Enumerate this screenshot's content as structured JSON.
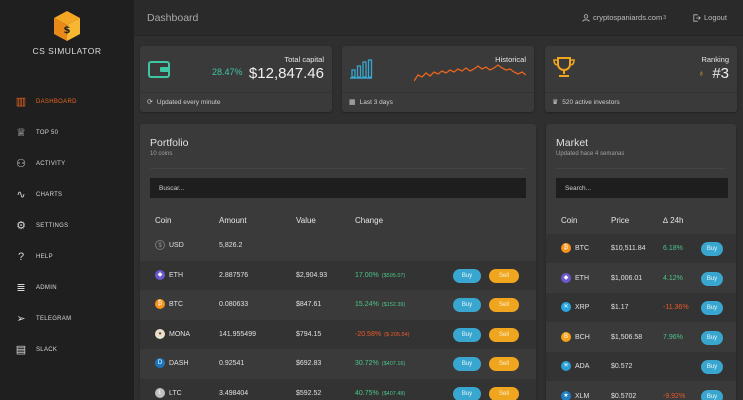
{
  "brand": {
    "name": "CS SIMULATOR"
  },
  "nav": [
    {
      "label": "DASHBOARD",
      "icon": "bar-chart-icon",
      "glyph": "▥",
      "active": true
    },
    {
      "label": "TOP 50",
      "icon": "trophy-icon",
      "glyph": "♕"
    },
    {
      "label": "ACTIVITY",
      "icon": "activity-icon",
      "glyph": "⚇"
    },
    {
      "label": "CHARTS",
      "icon": "pulse-icon",
      "glyph": "∿"
    },
    {
      "label": "SETTINGS",
      "icon": "gear-icon",
      "glyph": "⚙"
    },
    {
      "label": "HELP",
      "icon": "question-icon",
      "glyph": "?"
    },
    {
      "label": "ADMIN",
      "icon": "database-icon",
      "glyph": "≣"
    },
    {
      "label": "TELEGRAM",
      "icon": "send-icon",
      "glyph": "➢"
    },
    {
      "label": "SLACK",
      "icon": "chat-icon",
      "glyph": "▤"
    }
  ],
  "header": {
    "title": "Dashboard",
    "user": "cryptospaniards.com",
    "user_badge": "3",
    "logout": "Logout"
  },
  "stats": {
    "capital": {
      "label": "Total capital",
      "percent": "28.47%",
      "value": "$12,847.46",
      "footer": "Updated every minute"
    },
    "historical": {
      "label": "Historical",
      "footer": "Last 3 days"
    },
    "ranking": {
      "label": "Ranking",
      "value": "#3",
      "footer": "520 active investors"
    }
  },
  "portfolio": {
    "title": "Portfolio",
    "subtitle": "10 coins",
    "search_placeholder": "Buscar...",
    "columns": [
      "Coin",
      "Amount",
      "Value",
      "Change"
    ],
    "buy_label": "Buy",
    "sell_label": "Sell",
    "rows": [
      {
        "coin": "USD",
        "amount": "5,826.2",
        "value": "",
        "change": "",
        "change_sub": "",
        "trend": "",
        "icon_color": "#3a3a3a",
        "icon": "usd-coin-icon",
        "glyph": "$"
      },
      {
        "coin": "ETH",
        "amount": "2.887576",
        "value": "$2,904.93",
        "change": "17.00%",
        "change_sub": "($595.07)",
        "trend": "pos",
        "icon_color": "#6a5acd",
        "icon": "eth-coin-icon",
        "glyph": "◆"
      },
      {
        "coin": "BTC",
        "amount": "0.080633",
        "value": "$847.61",
        "change": "15.24%",
        "change_sub": "($152.39)",
        "trend": "pos",
        "icon_color": "#f7931a",
        "icon": "btc-coin-icon",
        "glyph": "₿"
      },
      {
        "coin": "MONA",
        "amount": "141.955499",
        "value": "$794.15",
        "change": "-20.58%",
        "change_sub": "($-205.84)",
        "trend": "neg",
        "icon_color": "#e8e0d0",
        "icon": "mona-coin-icon",
        "glyph": "●"
      },
      {
        "coin": "DASH",
        "amount": "0.92541",
        "value": "$692.83",
        "change": "30.72%",
        "change_sub": "($407.16)",
        "trend": "pos",
        "icon_color": "#1c75bc",
        "icon": "dash-coin-icon",
        "glyph": "D"
      },
      {
        "coin": "LTC",
        "amount": "3.498404",
        "value": "$592.52",
        "change": "40.75%",
        "change_sub": "($407.48)",
        "trend": "pos",
        "icon_color": "#bfbfbf",
        "icon": "ltc-coin-icon",
        "glyph": "Ł"
      }
    ]
  },
  "market": {
    "title": "Market",
    "subtitle": "Updated hace 4 semanas",
    "search_placeholder": "Search...",
    "columns": [
      "Coin",
      "Price",
      "∆ 24h"
    ],
    "buy_label": "Buy",
    "rows": [
      {
        "coin": "BTC",
        "price": "$10,511.84",
        "change": "6.18%",
        "trend": "pos",
        "icon_color": "#f7931a",
        "icon": "btc-coin-icon",
        "glyph": "₿"
      },
      {
        "coin": "ETH",
        "price": "$1,006.01",
        "change": "4.12%",
        "trend": "pos",
        "icon_color": "#6a5acd",
        "icon": "eth-coin-icon",
        "glyph": "◆"
      },
      {
        "coin": "XRP",
        "price": "$1.17",
        "change": "-11.36%",
        "trend": "neg",
        "icon_color": "#2aa6e0",
        "icon": "xrp-coin-icon",
        "glyph": "✕"
      },
      {
        "coin": "BCH",
        "price": "$1,506.58",
        "change": "7.96%",
        "trend": "pos",
        "icon_color": "#f7a21a",
        "icon": "bch-coin-icon",
        "glyph": "B"
      },
      {
        "coin": "ADA",
        "price": "$0.572",
        "change": "",
        "trend": "pos",
        "icon_color": "#2a9fd6",
        "icon": "ada-coin-icon",
        "glyph": "✳"
      },
      {
        "coin": "XLM",
        "price": "$0.5702",
        "change": "-9.92%",
        "trend": "neg",
        "icon_color": "#1f7fc4",
        "icon": "xlm-coin-icon",
        "glyph": "★"
      }
    ]
  },
  "colors": {
    "accent": "#e8651c",
    "gold": "#f0a51f",
    "buy": "#39a6cf",
    "positive": "#4cc48a",
    "negative": "#e85a2a"
  }
}
